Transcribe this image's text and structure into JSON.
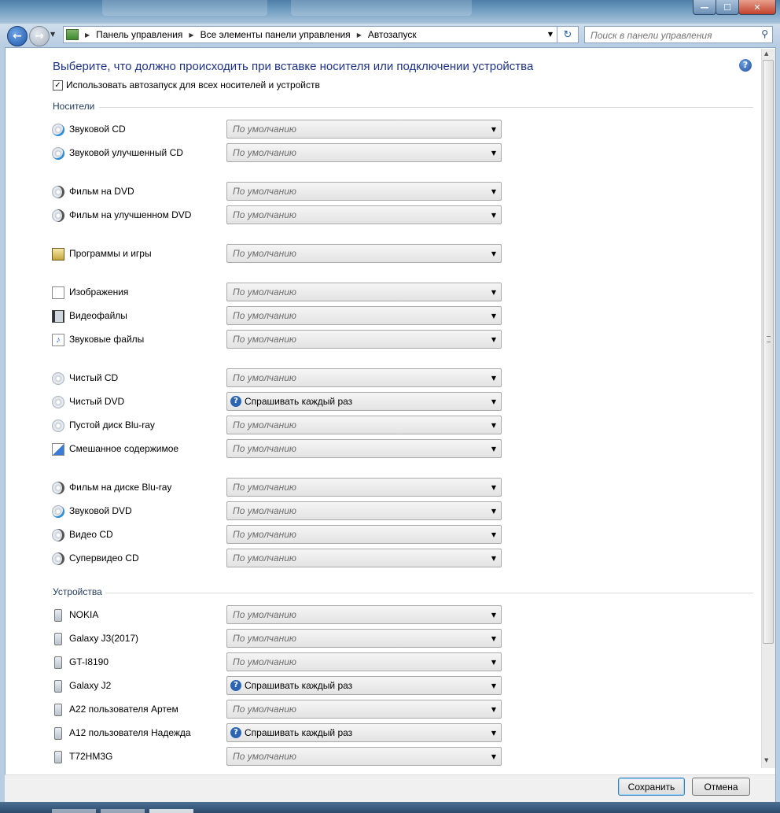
{
  "window": {
    "minimize_glyph": "—",
    "maximize_glyph": "☐",
    "close_glyph": "✕"
  },
  "nav": {
    "back_glyph": "←",
    "forward_glyph": "→",
    "breadcrumb": [
      "Панель управления",
      "Все элементы панели управления",
      "Автозапуск"
    ],
    "search_placeholder": "Поиск в панели управления"
  },
  "page": {
    "heading": "Выберите, что должно происходить при вставке носителя или подключении устройства",
    "autoplay_checkbox_label": "Использовать автозапуск для всех носителей и устройств",
    "autoplay_checked": true,
    "help_glyph": "?"
  },
  "media_section": {
    "title": "Носители",
    "items": [
      {
        "label": "Звуковой CD",
        "value": "По умолчанию",
        "icon": "audio-cd-icon"
      },
      {
        "label": "Звуковой улучшенный CD",
        "value": "По умолчанию",
        "icon": "enhanced-audio-cd-icon"
      },
      {
        "label": "Фильм на DVD",
        "value": "По умолчанию",
        "icon": "dvd-movie-icon"
      },
      {
        "label": "Фильм на улучшенном DVD",
        "value": "По умолчанию",
        "icon": "enhanced-dvd-movie-icon"
      },
      {
        "label": "Программы и игры",
        "value": "По умолчанию",
        "icon": "software-games-icon"
      },
      {
        "label": "Изображения",
        "value": "По умолчанию",
        "icon": "pictures-icon"
      },
      {
        "label": "Видеофайлы",
        "value": "По умолчанию",
        "icon": "video-files-icon"
      },
      {
        "label": "Звуковые файлы",
        "value": "По умолчанию",
        "icon": "audio-files-icon"
      },
      {
        "label": "Чистый CD",
        "value": "По умолчанию",
        "icon": "blank-cd-icon"
      },
      {
        "label": "Чистый DVD",
        "value": "Спрашивать каждый раз",
        "icon": "blank-dvd-icon"
      },
      {
        "label": "Пустой диск Blu-ray",
        "value": "По умолчанию",
        "icon": "blank-bluray-icon"
      },
      {
        "label": "Смешанное содержимое",
        "value": "По умолчанию",
        "icon": "mixed-content-icon"
      },
      {
        "label": "Фильм на диске Blu-ray",
        "value": "По умолчанию",
        "icon": "bluray-movie-icon"
      },
      {
        "label": "Звуковой DVD",
        "value": "По умолчанию",
        "icon": "dvd-audio-icon"
      },
      {
        "label": "Видео CD",
        "value": "По умолчанию",
        "icon": "video-cd-icon"
      },
      {
        "label": "Супервидео CD",
        "value": "По умолчанию",
        "icon": "super-video-cd-icon"
      }
    ]
  },
  "devices_section": {
    "title": "Устройства",
    "items": [
      {
        "label": "NOKIA",
        "value": "По умолчанию",
        "icon": "phone-device-icon"
      },
      {
        "label": "Galaxy J3(2017)",
        "value": "По умолчанию",
        "icon": "phone-device-icon"
      },
      {
        "label": "GT-I8190",
        "value": "По умолчанию",
        "icon": "phone-device-icon"
      },
      {
        "label": "Galaxy J2",
        "value": "Спрашивать каждый раз",
        "icon": "phone-device-icon"
      },
      {
        "label": "A22 пользователя Артем",
        "value": "По умолчанию",
        "icon": "phone-device-icon"
      },
      {
        "label": "A12 пользователя Надежда",
        "value": "Спрашивать каждый раз",
        "icon": "phone-device-icon"
      },
      {
        "label": "T72HM3G",
        "value": "По умолчанию",
        "icon": "phone-device-icon"
      }
    ]
  },
  "footer": {
    "save_label": "Сохранить",
    "cancel_label": "Отмена"
  },
  "default_value": "По умолчанию"
}
